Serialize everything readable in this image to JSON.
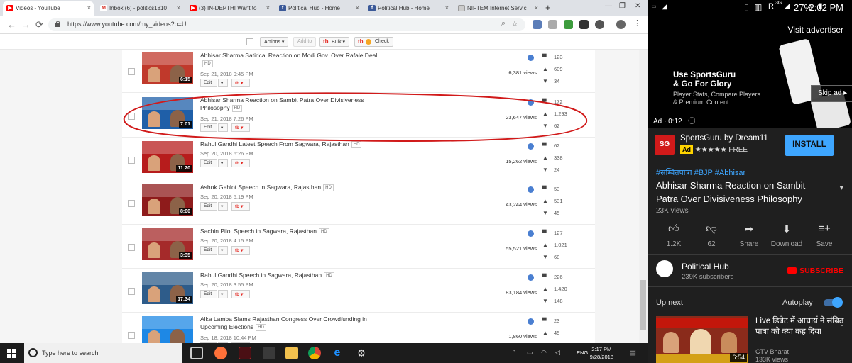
{
  "browser": {
    "tabs": [
      {
        "title": "Videos - YouTube",
        "icon": "youtube-icon",
        "color": "#ff0000"
      },
      {
        "title": "Inbox (6) - politics1810",
        "icon": "gmail-icon",
        "color": "#d93025"
      },
      {
        "title": "(3) IN-DEPTH! Want to",
        "icon": "youtube-icon",
        "color": "#ff0000"
      },
      {
        "title": "Political Hub - Home",
        "icon": "facebook-icon",
        "color": "#3b5998"
      },
      {
        "title": "Political Hub - Home",
        "icon": "facebook-icon",
        "color": "#3b5998"
      },
      {
        "title": "NIFTEM Internet Servic",
        "icon": "document-icon",
        "color": "#888888"
      }
    ],
    "new_tab": "+",
    "url": "https://www.youtube.com/my_videos?o=U"
  },
  "toolbar": {
    "actions": "Actions ▾",
    "add_to": "Add to",
    "bulk": "Bulk ▾",
    "check": "Check"
  },
  "videos": [
    {
      "title": "Abhisar Sharma Satirical Reaction on Modi Gov. Over Rafale Deal",
      "hd": "HD",
      "date": "Sep 21, 2018 9:45 PM",
      "duration": "6:15",
      "views": "6,381 views",
      "comments": "123",
      "likes": "609",
      "dislikes": "34",
      "thumb_color": "#c0392b"
    },
    {
      "title": "Abhisar Sharma Reaction on Sambit Patra Over Divisiveness Philosophy",
      "hd": "HD",
      "date": "Sep 21, 2018 7:26 PM",
      "duration": "7:01",
      "views": "23,647 views",
      "comments": "172",
      "likes": "1,293",
      "dislikes": "62",
      "thumb_color": "#1f5fa8"
    },
    {
      "title": "Rahul Gandhi Latest Speech From Sagwara, Rajasthan",
      "hd": "HD",
      "date": "Sep 20, 2018 6:26 PM",
      "duration": "11:20",
      "views": "15,262 views",
      "comments": "62",
      "likes": "338",
      "dislikes": "24",
      "thumb_color": "#b71c1c"
    },
    {
      "title": "Ashok Gehlot Speech in Sagwara, Rajasthan",
      "hd": "HD",
      "date": "Sep 20, 2018 5:19 PM",
      "duration": "8:00",
      "views": "43,244 views",
      "comments": "53",
      "likes": "531",
      "dislikes": "45",
      "thumb_color": "#8e1b1b"
    },
    {
      "title": "Sachin Pilot Speech in Sagwara, Rajasthan",
      "hd": "HD",
      "date": "Sep 20, 2018 4:15 PM",
      "duration": "3:35",
      "views": "55,521 views",
      "comments": "127",
      "likes": "1,021",
      "dislikes": "68",
      "thumb_color": "#a52a2a"
    },
    {
      "title": "Rahul Gandhi Speech in Sagwara, Rajasthan",
      "hd": "HD",
      "date": "Sep 20, 2018 3:55 PM",
      "duration": "17:34",
      "views": "83,184 views",
      "comments": "226",
      "likes": "1,420",
      "dislikes": "148",
      "thumb_color": "#2e5c8a"
    },
    {
      "title": "Alka Lamba Slams Rajasthan Congress Over Crowdfunding in Upcoming Elections",
      "hd": "HD",
      "date": "Sep 18, 2018 10:44 PM",
      "duration": "",
      "views": "1,860 views",
      "comments": "23",
      "likes": "45",
      "dislikes": "",
      "thumb_color": "#1e88e5"
    }
  ],
  "edit_label": "Edit",
  "taskbar": {
    "search_placeholder": "Type here to search",
    "lang": "ENG",
    "time": "2:17 PM",
    "date": "9/28/2018"
  },
  "phone": {
    "carrier_badge": "R",
    "net": "3G",
    "battery": "27%",
    "clock": "2:02 PM",
    "visit_advertiser": "Visit advertiser",
    "ad_headline_1": "Use SportsGuru",
    "ad_headline_2": "& Go For Glory",
    "ad_sub_1": "Player Stats, Compare Players",
    "ad_sub_2": "& Premium Content",
    "skip_ad": "Skip ad ▸|",
    "ad_time": "Ad · 0:12",
    "advertiser": "SportsGuru by Dream11",
    "ad_badge": "Ad",
    "rating": "★★★★★",
    "price": "FREE",
    "install": "INSTALL",
    "tags": "#सम्बितपात्रा #BJP #Abhisar",
    "video_title": "Abhisar Sharma Reaction on Sambit Patra Over Divisiveness Philosophy",
    "views": "23K views",
    "actions": [
      {
        "label": "1.2K",
        "icon": "thumbs-up-icon"
      },
      {
        "label": "62",
        "icon": "thumbs-down-icon"
      },
      {
        "label": "Share",
        "icon": "share-icon"
      },
      {
        "label": "Download",
        "icon": "download-icon"
      },
      {
        "label": "Save",
        "icon": "save-icon"
      }
    ],
    "channel": "Political Hub",
    "subscribers": "239K subscribers",
    "subscribe": "SUBSCRIBE",
    "up_next": "Up next",
    "autoplay": "Autoplay",
    "next_title": "Live डिबेट में आचार्य ने संबित पात्रा को क्या कह दिया",
    "next_channel": "CTV Bharat",
    "next_views": "133K views",
    "next_duration": "6:54"
  },
  "colors": {
    "youtube_red": "#ff0000",
    "annotation_red": "#d11a1a",
    "phone_accent": "#3ea6ff"
  }
}
